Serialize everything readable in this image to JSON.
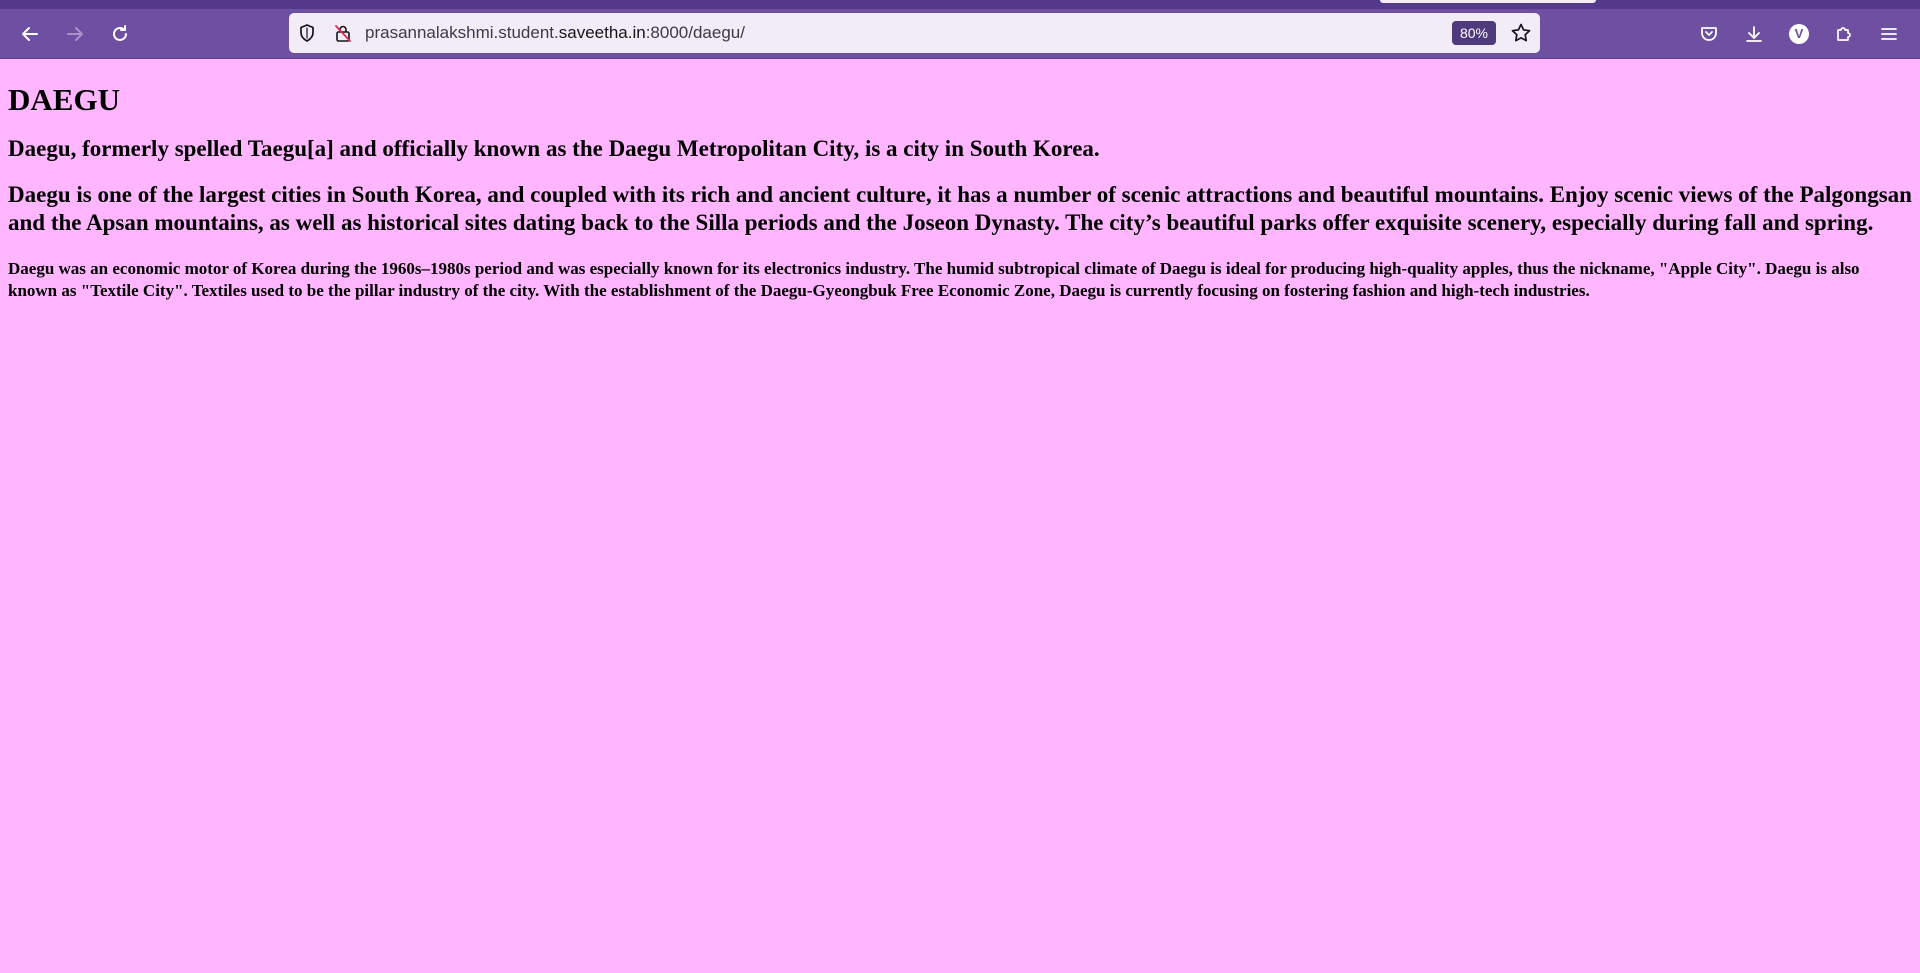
{
  "browser": {
    "url_prefix": "prasannalakshmi.student.",
    "url_host": "saveetha.in",
    "url_suffix": ":8000/daegu/",
    "zoom_level": "80%",
    "profile_initial": "V",
    "theme_colors": {
      "frame": "#553a8c",
      "toolbar": "#6e4fa2",
      "urlbar": "#f2ecf7",
      "page_background": "#ffb6ff"
    }
  },
  "icons": {
    "back": "back-arrow-icon",
    "forward": "forward-arrow-icon",
    "reload": "reload-icon",
    "tracking": "shield-icon",
    "connection": "insecure-lock-icon",
    "bookmark": "star-icon",
    "pocket": "pocket-icon",
    "downloads": "download-icon",
    "account": "avatar",
    "extensions": "puzzle-icon",
    "menu": "hamburger-menu-icon"
  },
  "page": {
    "title": "DAEGU",
    "intro": "Daegu, formerly spelled Taegu[a] and officially known as the Daegu Metropolitan City, is a city in South Korea.",
    "description": "Daegu is one of the largest cities in South Korea, and coupled with its rich and ancient culture, it has a number of scenic attractions and beautiful mountains. Enjoy scenic views of the Palgongsan and the Apsan mountains, as well as historical sites dating back to the Silla periods and the Joseon Dynasty. The city’s beautiful parks offer exquisite scenery, especially during fall and spring.",
    "economy": "Daegu was an economic motor of Korea during the 1960s–1980s period and was especially known for its electronics industry. The humid subtropical climate of Daegu is ideal for producing high-quality apples, thus the nickname, \"Apple City\". Daegu is also known as \"Textile City\". Textiles used to be the pillar industry of the city. With the establishment of the Daegu-Gyeongbuk Free Economic Zone, Daegu is currently focusing on fostering fashion and high-tech industries."
  }
}
